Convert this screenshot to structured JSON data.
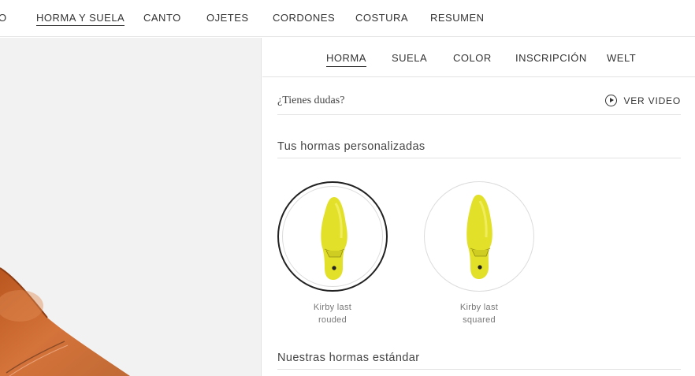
{
  "topnav": {
    "items": [
      {
        "label": "O"
      },
      {
        "label": "HORMA Y SUELA",
        "active": true
      },
      {
        "label": "CANTO"
      },
      {
        "label": "OJETES"
      },
      {
        "label": "CORDONES"
      },
      {
        "label": "COSTURA"
      },
      {
        "label": "RESUMEN"
      }
    ]
  },
  "subnav": {
    "items": [
      {
        "label": "HORMA",
        "active": true
      },
      {
        "label": "SUELA"
      },
      {
        "label": "COLOR"
      },
      {
        "label": "INSCRIPCIÓN"
      },
      {
        "label": "WELT"
      }
    ]
  },
  "help": {
    "question": "¿Tienes dudas?",
    "video_label": "VER VIDEO",
    "video_icon": "play-circle-icon"
  },
  "custom_lasts": {
    "title": "Tus hormas personalizadas",
    "items": [
      {
        "line1": "Kirby last",
        "line2": "rouded",
        "selected": true,
        "icon": "shoe-last-icon",
        "color": "#e3e02a"
      },
      {
        "line1": "Kirby last",
        "line2": "squared",
        "selected": false,
        "icon": "shoe-last-icon",
        "color": "#e3e02a"
      }
    ]
  },
  "standard_lasts": {
    "title": "Nuestras hormas estándar"
  },
  "colors": {
    "accent_yellow": "#e3e02a",
    "shoe_leather": "#c8652a"
  }
}
